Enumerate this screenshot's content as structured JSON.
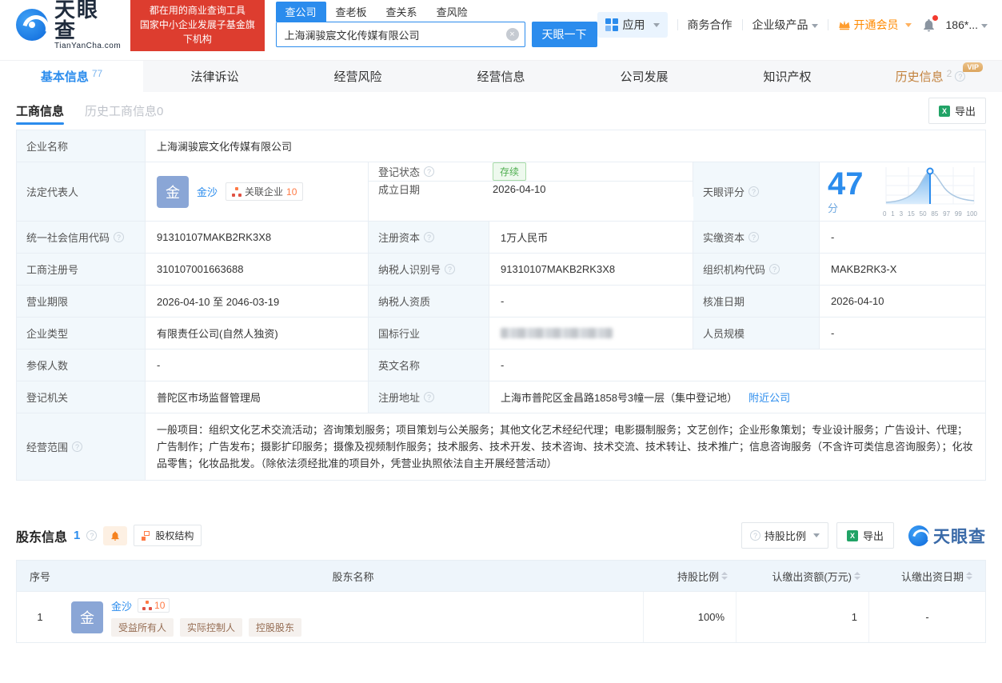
{
  "colors": {
    "accent": "#2b8ced",
    "banner_red": "#dd3d2f",
    "status_green": "#4fae50",
    "vip_orange": "#ff8a00",
    "label_bg": "#f2f8fc"
  },
  "header": {
    "brand": "天眼查",
    "brand_domain": "TianYanCha.com",
    "banner_line1": "都在用的商业查询工具",
    "banner_line2": "国家中小企业发展子基金旗下机构",
    "search": {
      "tabs": [
        {
          "label": "查公司"
        },
        {
          "label": "查老板"
        },
        {
          "label": "查关系"
        },
        {
          "label": "查风险"
        }
      ],
      "value": "上海澜骏宸文化传媒有限公司",
      "button": "天眼一下"
    },
    "nav": {
      "apps": "应用",
      "cooperation": "商务合作",
      "enterprise": "企业级产品",
      "vip": "开通会员",
      "user": "186*..."
    }
  },
  "tabs": [
    {
      "label": "基本信息",
      "count": "77"
    },
    {
      "label": "法律诉讼"
    },
    {
      "label": "经营风险"
    },
    {
      "label": "经营信息"
    },
    {
      "label": "公司发展"
    },
    {
      "label": "知识产权"
    },
    {
      "label": "历史信息",
      "count": "2",
      "badge": "VIP"
    }
  ],
  "subtabs": {
    "active": "工商信息",
    "inactive": "历史工商信息0",
    "export": "导出"
  },
  "info": {
    "company_name": {
      "label": "企业名称",
      "value": "上海澜骏宸文化传媒有限公司"
    },
    "legal": {
      "label": "法定代表人",
      "avatar": "金",
      "name": "金沙",
      "related": "关联企业",
      "related_count": "10"
    },
    "reg_status": {
      "label": "登记状态",
      "value": "存续"
    },
    "est_date": {
      "label": "成立日期",
      "value": "2026-04-10"
    },
    "score": {
      "label": "天眼评分",
      "value": "47",
      "unit": "分",
      "axis": [
        "0",
        "1",
        "3",
        "15",
        "50",
        "85",
        "97",
        "99",
        "100"
      ]
    },
    "credit_code": {
      "label": "统一社会信用代码",
      "value": "91310107MAKB2RK3X8"
    },
    "reg_capital": {
      "label": "注册资本",
      "value": "1万人民币"
    },
    "paid_capital": {
      "label": "实缴资本",
      "value": "-"
    },
    "reg_number": {
      "label": "工商注册号",
      "value": "310107001663688"
    },
    "tax_id": {
      "label": "纳税人识别号",
      "value": "91310107MAKB2RK3X8"
    },
    "org_code": {
      "label": "组织机构代码",
      "value": "MAKB2RK3-X"
    },
    "biz_term": {
      "label": "营业期限",
      "value": "2026-04-10 至 2046-03-19"
    },
    "tax_qual": {
      "label": "纳税人资质",
      "value": "-"
    },
    "approval_date": {
      "label": "核准日期",
      "value": "2026-04-10"
    },
    "company_type": {
      "label": "企业类型",
      "value": "有限责任公司(自然人独资)"
    },
    "industry": {
      "label": "国标行业"
    },
    "staff_size": {
      "label": "人员规模",
      "value": "-"
    },
    "insured": {
      "label": "参保人数",
      "value": "-"
    },
    "english_name": {
      "label": "英文名称",
      "value": "-"
    },
    "reg_authority": {
      "label": "登记机关",
      "value": "普陀区市场监督管理局"
    },
    "reg_address": {
      "label": "注册地址",
      "value": "上海市普陀区金昌路1858号3幢一层（集中登记地）",
      "link": "附近公司"
    },
    "scope": {
      "label": "经营范围",
      "value": "一般项目：组织文化艺术交流活动；咨询策划服务；项目策划与公关服务；其他文化艺术经纪代理；电影摄制服务；文艺创作；企业形象策划；专业设计服务；广告设计、代理；广告制作；广告发布；摄影扩印服务；摄像及视频制作服务；技术服务、技术开发、技术咨询、技术交流、技术转让、技术推广；信息咨询服务（不含许可类信息咨询服务）；化妆品零售；化妆品批发。（除依法须经批准的项目外，凭营业执照依法自主开展经营活动）"
    }
  },
  "shareholders": {
    "title": "股东信息",
    "count": "1",
    "equity_button": "股权结构",
    "ratio_button": "持股比例",
    "export_button": "导出",
    "watermark": "天眼查",
    "columns": [
      "序号",
      "股东名称",
      "持股比例",
      "认缴出资额(万元)",
      "认缴出资日期"
    ],
    "rows": [
      {
        "index": "1",
        "avatar": "金",
        "name": "金沙",
        "badge_count": "10",
        "tags": [
          "受益所有人",
          "实际控制人",
          "控股股东"
        ],
        "ratio": "100%",
        "amount": "1",
        "date": "-"
      }
    ]
  }
}
